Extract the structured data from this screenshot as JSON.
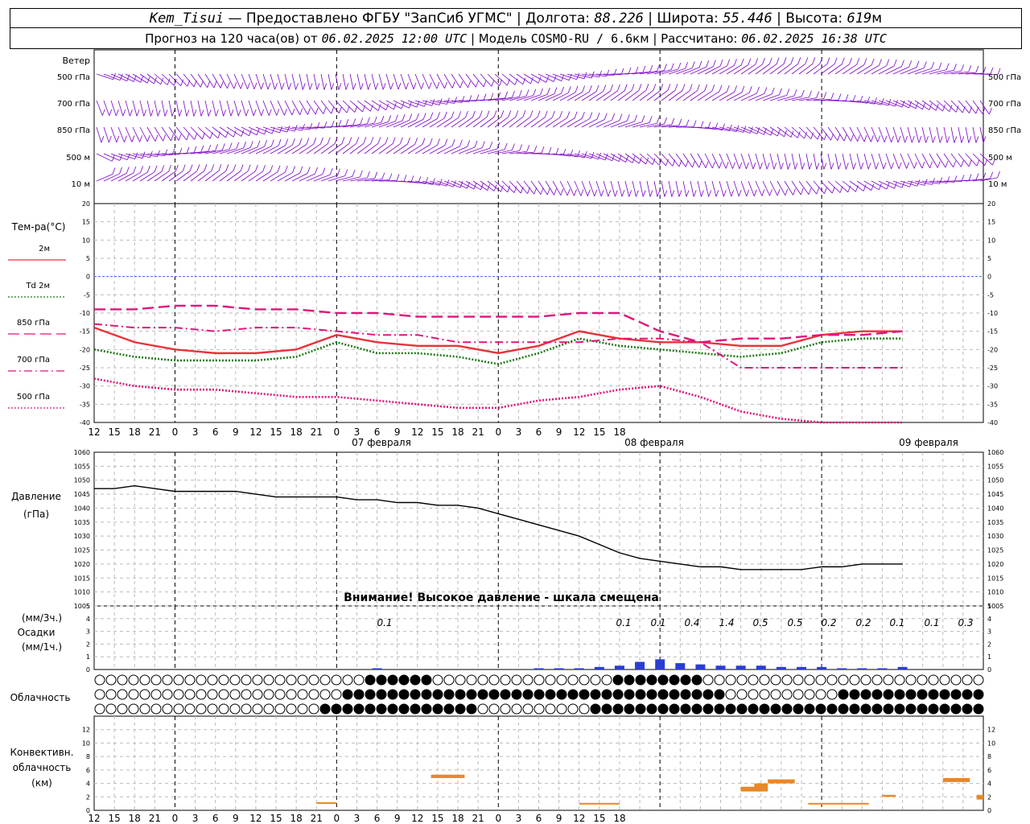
{
  "header": {
    "station": "Kem_Tisui",
    "provider": "— Предоставлено ФГБУ \"ЗапСиб УГМС\" | Долгота:",
    "longitude": "88.226",
    "lat_label": "| Широта:",
    "latitude": "55.446",
    "alt_label": "| Высота:",
    "altitude": "619",
    "alt_unit": "м",
    "forecast_label": "Прогноз на 120 часа(ов) от",
    "forecast_time": "06.02.2025 12:00 UTC",
    "model_label": "| Модель",
    "model": "COSMO-RU / 6.6",
    "model_unit": "км | Рассчитано:",
    "computed": "06.02.2025 16:38 UTC"
  },
  "wind_panel": {
    "title": "Ветер",
    "levels": [
      "500 гПа",
      "700 гПа",
      "850 гПа",
      "500 м",
      "10 м"
    ],
    "colors": {
      "barb": "#7b00c8"
    }
  },
  "temperature_panel": {
    "title": "Тем-ра(°C)",
    "legend": [
      {
        "label": "2м",
        "color": "#e8333a",
        "style": "solid"
      },
      {
        "label": "Td 2м",
        "color": "#1f7a14",
        "style": "dotted"
      },
      {
        "label": "850 гПа",
        "color": "#e0157a",
        "style": "longdash"
      },
      {
        "label": "700 гПа",
        "color": "#e0157a",
        "style": "dashdot"
      },
      {
        "label": "500 гПа",
        "color": "#e0157a",
        "style": "dotted"
      }
    ]
  },
  "pressure_panel": {
    "title": "Давление",
    "unit": "(гПа)",
    "warning": "Внимание! Высокое давление - шкала смещена"
  },
  "precip_panel": {
    "unit3": "(мм/3ч.)",
    "title": "Осадки",
    "unit1": "(мм/1ч.)",
    "labels": [
      "0.1",
      "0.1",
      "0.1",
      "0.4",
      "1.4",
      "0.5",
      "0.5",
      "0.2",
      "0.2",
      "0.1",
      "0.1",
      "0.3"
    ]
  },
  "cloud_panel": {
    "title": "Облачность"
  },
  "convective_panel": {
    "title1": "Конвективн.",
    "title2": "облачность",
    "title3": "(км)"
  },
  "axis": {
    "hour_labels": [
      "12",
      "15",
      "18",
      "21",
      "0",
      "3",
      "6",
      "9",
      "12",
      "15",
      "18",
      "21",
      "0",
      "3",
      "6",
      "9",
      "12",
      "15",
      "18",
      "21",
      "0",
      "3",
      "6",
      "9",
      "12",
      "15",
      "18"
    ],
    "day_labels": [
      "07 февраля",
      "08 февраля",
      "09 февраля"
    ]
  },
  "chart_data": [
    {
      "type": "line",
      "name": "temperature",
      "x_hours": [
        0,
        6,
        12,
        18,
        24,
        30,
        36,
        42,
        48,
        54,
        60,
        66,
        72,
        78,
        84,
        90,
        96,
        102,
        108,
        114,
        120
      ],
      "ylim": [
        -40,
        20
      ],
      "yticks": [
        20,
        15,
        10,
        5,
        0,
        -5,
        -10,
        -15,
        -20,
        -25,
        -30,
        -35,
        -40
      ],
      "series": [
        {
          "name": "2м",
          "values": [
            -14,
            -18,
            -20,
            -21,
            -21,
            -20,
            -16,
            -18,
            -19,
            -19,
            -21,
            -19,
            -15,
            -17,
            -18,
            -18,
            -19,
            -19,
            -16,
            -15,
            -15
          ]
        },
        {
          "name": "Td 2м",
          "values": [
            -20,
            -22,
            -23,
            -23,
            -23,
            -22,
            -18,
            -21,
            -21,
            -22,
            -24,
            -21,
            -17,
            -19,
            -20,
            -21,
            -22,
            -21,
            -18,
            -17,
            -17
          ]
        },
        {
          "name": "850 гПа",
          "values": [
            -9,
            -9,
            -8,
            -8,
            -9,
            -9,
            -10,
            -10,
            -11,
            -11,
            -11,
            -11,
            -10,
            -10,
            -15,
            -18,
            -17,
            -17,
            -16,
            -16,
            -15
          ]
        },
        {
          "name": "700 гПа",
          "values": [
            -13,
            -14,
            -14,
            -15,
            -14,
            -14,
            -15,
            -16,
            -16,
            -18,
            -18,
            -18,
            -18,
            -17,
            -17,
            -18,
            -25,
            -25,
            -25,
            -25,
            -25
          ]
        },
        {
          "name": "500 гПа",
          "values": [
            -28,
            -30,
            -31,
            -31,
            -32,
            -33,
            -33,
            -34,
            -35,
            -36,
            -36,
            -34,
            -33,
            -31,
            -30,
            -33,
            -37,
            -39,
            -40,
            -40,
            -40
          ]
        }
      ]
    },
    {
      "type": "line",
      "name": "pressure",
      "x_hours": [
        0,
        3,
        6,
        9,
        12,
        15,
        18,
        21,
        24,
        27,
        30,
        33,
        36,
        39,
        42,
        45,
        48,
        51,
        54,
        57,
        60,
        63,
        66,
        69,
        72,
        75,
        78,
        81,
        84,
        87,
        90,
        93,
        96,
        99,
        102,
        105,
        108,
        111,
        114,
        117,
        120
      ],
      "ylim": [
        1005,
        1060
      ],
      "yticks": [
        1060,
        1055,
        1050,
        1045,
        1040,
        1035,
        1030,
        1025,
        1020,
        1015,
        1010,
        1005
      ],
      "series": [
        {
          "name": "",
          "values": [
            1047,
            1047,
            1048,
            1047,
            1046,
            1046,
            1046,
            1046,
            1045,
            1044,
            1044,
            1044,
            1044,
            1043,
            1043,
            1042,
            1042,
            1041,
            1041,
            1040,
            1038,
            1036,
            1034,
            1032,
            1030,
            1027,
            1024,
            1022,
            1021,
            1020,
            1019,
            1019,
            1018,
            1018,
            1018,
            1018,
            1019,
            1019,
            1020,
            1020,
            1020
          ]
        }
      ]
    },
    {
      "type": "bar",
      "name": "precipitation",
      "x_hours": [
        42,
        66,
        69,
        72,
        75,
        78,
        81,
        84,
        87,
        90,
        93,
        96,
        99,
        102,
        105,
        108,
        111,
        114,
        117,
        120
      ],
      "values": [
        0.1,
        0.1,
        0.1,
        0.1,
        0.2,
        0.3,
        0.6,
        0.8,
        0.5,
        0.4,
        0.3,
        0.3,
        0.3,
        0.2,
        0.2,
        0.2,
        0.1,
        0.1,
        0.1,
        0.2
      ],
      "ylim": [
        0,
        5
      ]
    },
    {
      "type": "bar",
      "name": "convective_cloud",
      "ylim": [
        0,
        14
      ],
      "segments": [
        {
          "start_h": 33,
          "end_h": 36,
          "base": 1.0,
          "top": 1.2
        },
        {
          "start_h": 50,
          "end_h": 55,
          "base": 4.8,
          "top": 5.3
        },
        {
          "start_h": 72,
          "end_h": 78,
          "base": 0.9,
          "top": 1.1
        },
        {
          "start_h": 96,
          "end_h": 99,
          "base": 2.8,
          "top": 3.5
        },
        {
          "start_h": 98,
          "end_h": 100,
          "base": 2.8,
          "top": 4.0
        },
        {
          "start_h": 100,
          "end_h": 104,
          "base": 4.0,
          "top": 4.6
        },
        {
          "start_h": 106,
          "end_h": 115,
          "base": 0.9,
          "top": 1.1
        },
        {
          "start_h": 117,
          "end_h": 119,
          "base": 2.0,
          "top": 2.3
        },
        {
          "start_h": 126,
          "end_h": 130,
          "base": 4.2,
          "top": 4.8
        },
        {
          "start_h": 131,
          "end_h": 132,
          "base": 1.6,
          "top": 2.3
        }
      ],
      "color": "#e8882a"
    }
  ]
}
